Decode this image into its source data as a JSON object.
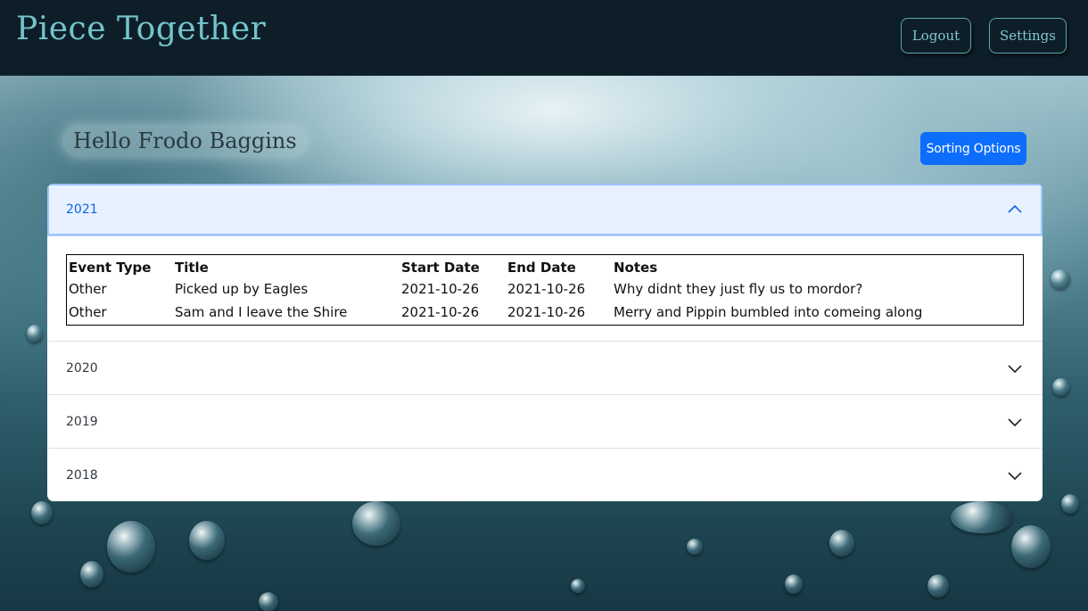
{
  "header": {
    "brand": "Piece Together",
    "logout_label": "Logout",
    "settings_label": "Settings"
  },
  "main": {
    "greeting": "Hello Frodo Baggins",
    "sort_label": "Sorting Options"
  },
  "accordion": {
    "sections": [
      {
        "label": "2021",
        "expanded": true
      },
      {
        "label": "2020",
        "expanded": false
      },
      {
        "label": "2019",
        "expanded": false
      },
      {
        "label": "2018",
        "expanded": false
      }
    ],
    "table": {
      "headers": [
        "Event Type",
        "Title",
        "Start Date",
        "End Date",
        "Notes"
      ],
      "rows": [
        [
          "Other",
          "Picked up by Eagles",
          "2021-10-26",
          "2021-10-26",
          "Why didnt they just fly us to mordor?"
        ],
        [
          "Other",
          "Sam and I leave the Shire",
          "2021-10-26",
          "2021-10-26",
          "Merry and Pippin bumbled into comeing along"
        ]
      ]
    }
  },
  "colors": {
    "header_bg": "#0e1e28",
    "brand": "#74c4cc",
    "primary_button": "#0d6efd",
    "accordion_open_bg": "#e7f1ff",
    "accordion_open_text": "#0c63e4"
  },
  "icons": {
    "chevron_up": "chevron-up-icon",
    "chevron_down": "chevron-down-icon"
  }
}
